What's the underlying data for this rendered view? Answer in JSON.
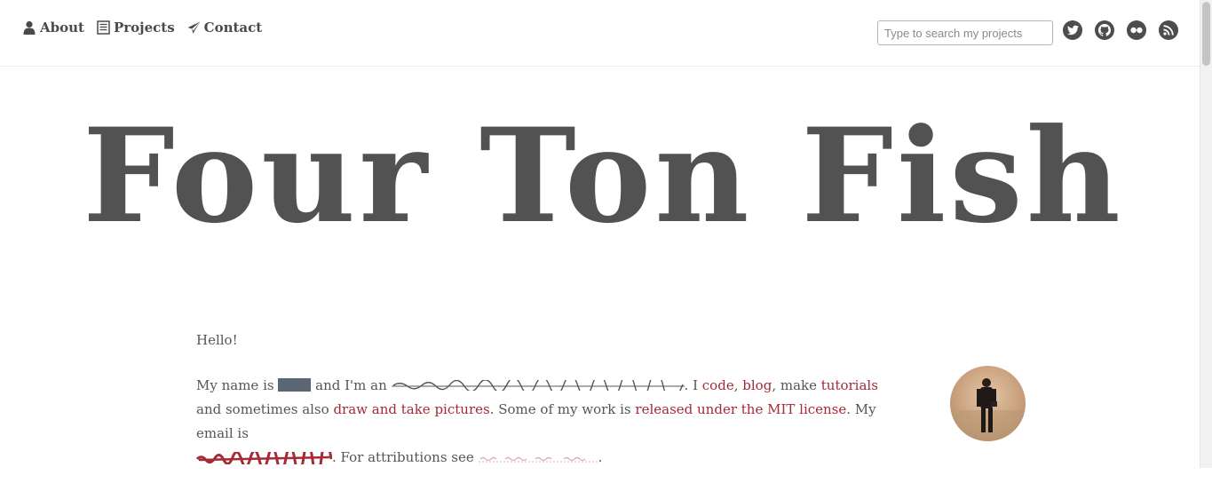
{
  "nav": {
    "items": [
      {
        "label": "About",
        "icon": "user-icon"
      },
      {
        "label": "Projects",
        "icon": "list-icon"
      },
      {
        "label": "Contact",
        "icon": "paper-plane-icon"
      }
    ]
  },
  "search": {
    "placeholder": "Type to search my projects",
    "value": ""
  },
  "social": [
    "twitter-icon",
    "github-icon",
    "flickr-icon",
    "rss-icon"
  ],
  "hero": {
    "title": "Four Ton Fish"
  },
  "intro": {
    "greeting": "Hello!",
    "p_name_is": "My name is",
    "p_and_im_an": " and I'm an",
    "p_i": ". I",
    "link_code": "code",
    "comma1": ",",
    "link_blog": "blog",
    "p_make": ", make",
    "link_tutorials": "tutorials",
    "p_and_sometimes": " and sometimes also",
    "link_draw": "draw and take pictures",
    "p_some_work": ". Some of my work is",
    "link_mit": "released under the MIT license",
    "p_email_is": ". My email is",
    "p_attributions": ". For attributions see",
    "period": "."
  },
  "colors": {
    "accent": "#a52a35",
    "text": "#525252",
    "redaction": "#5b6773"
  }
}
